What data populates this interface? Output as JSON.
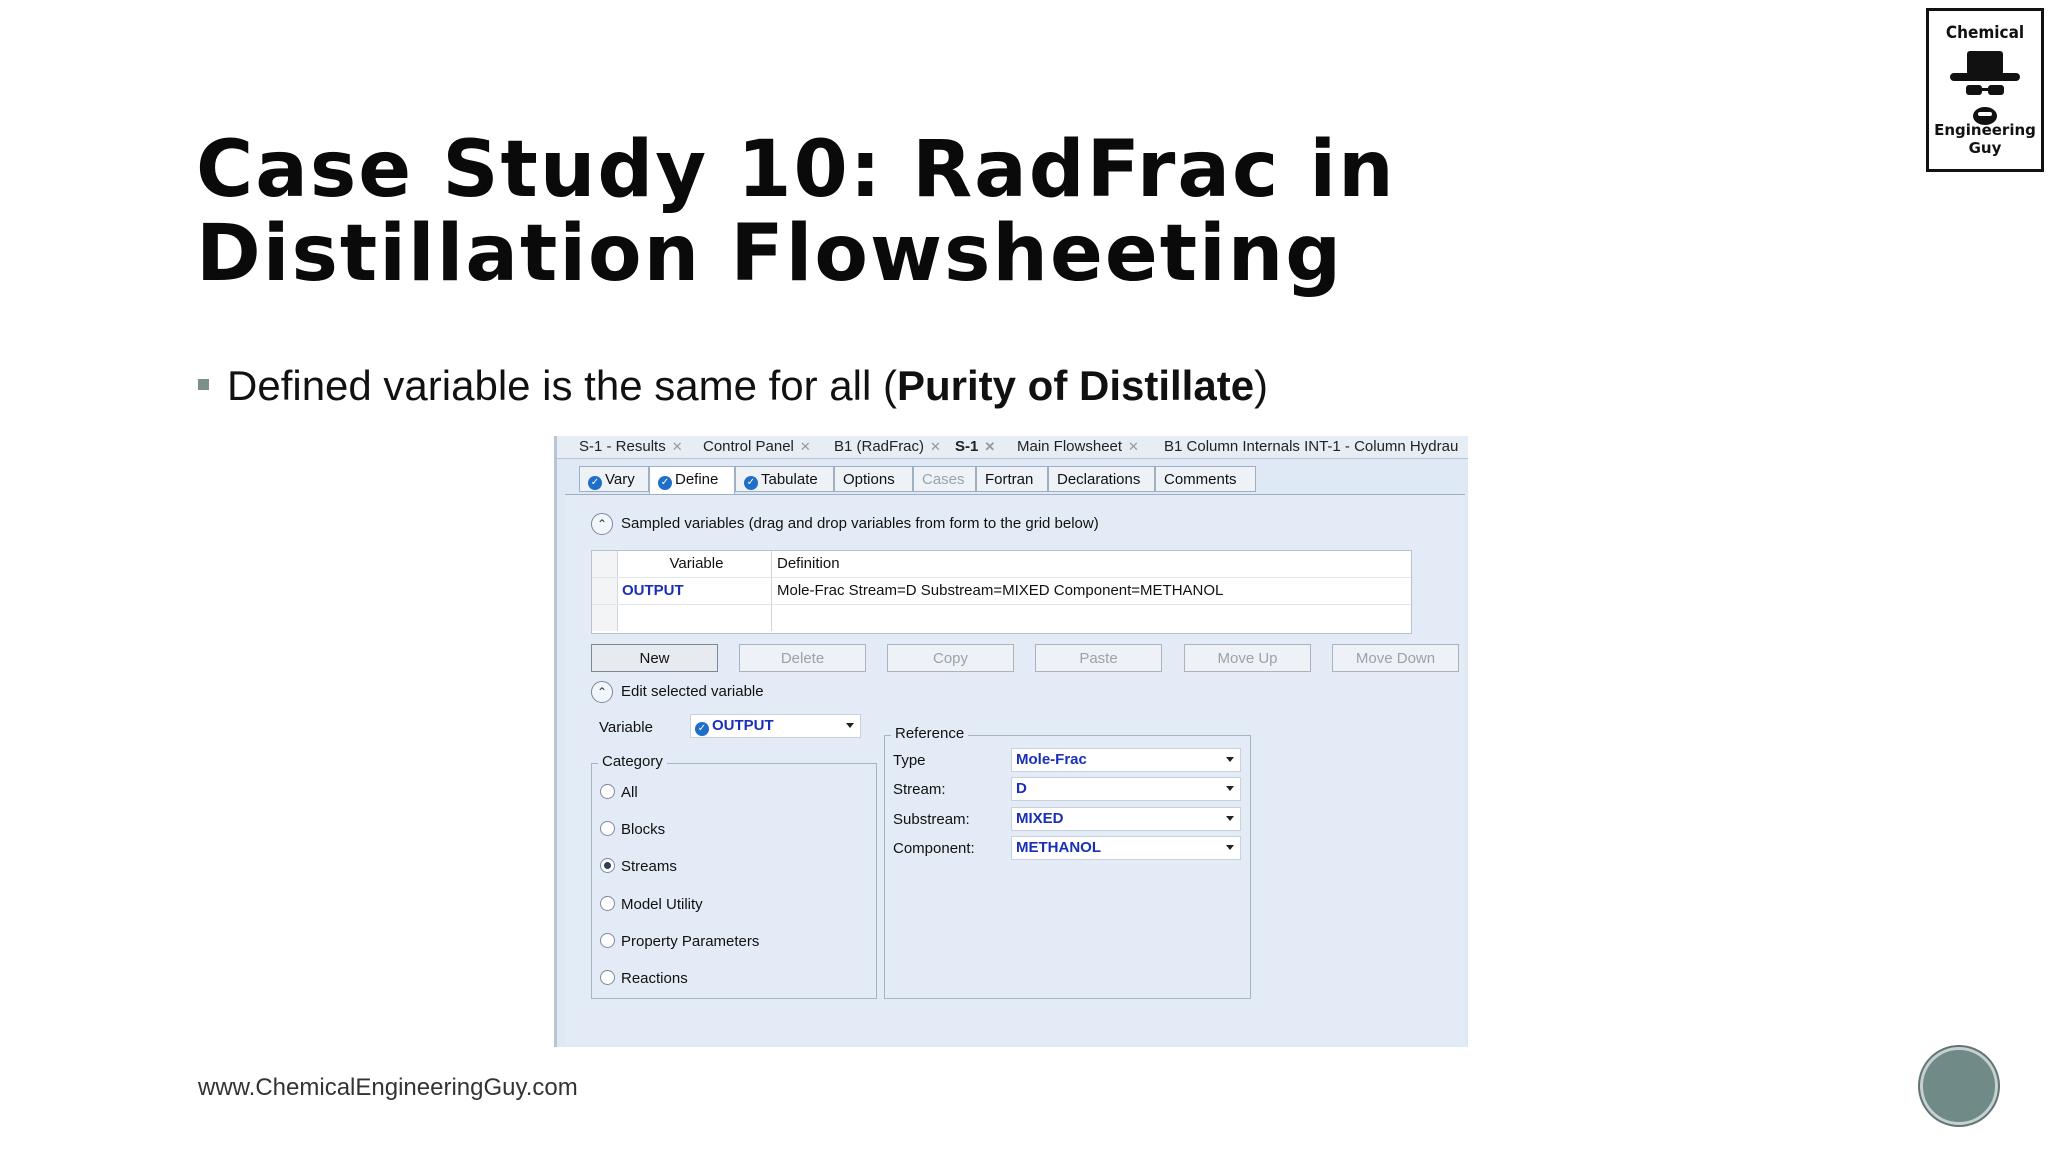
{
  "slide": {
    "title": "Case Study 10: RadFrac in Distillation Flowsheeting",
    "bullet_prefix": "Defined variable is the same for all (",
    "bullet_bold": "Purity of Distillate",
    "bullet_suffix": ")",
    "footer_url": "www.ChemicalEngineeringGuy.com",
    "logo_top": "Chemical",
    "logo_bottom": "Engineering Guy"
  },
  "doc_tabs": [
    {
      "label": "S-1 - Results"
    },
    {
      "label": "Control Panel"
    },
    {
      "label": "B1 (RadFrac)"
    },
    {
      "label": "S-1",
      "active": true
    },
    {
      "label": "Main Flowsheet"
    },
    {
      "label": "B1 Column Internals INT-1 - Column Hydrau"
    }
  ],
  "form_tabs": [
    {
      "label": "Vary",
      "checked": true
    },
    {
      "label": "Define",
      "checked": true,
      "active": true
    },
    {
      "label": "Tabulate",
      "checked": true
    },
    {
      "label": "Options"
    },
    {
      "label": "Cases",
      "disabled": true
    },
    {
      "label": "Fortran"
    },
    {
      "label": "Declarations"
    },
    {
      "label": "Comments"
    }
  ],
  "sampled": {
    "header": "Sampled variables (drag and drop variables from form to the grid below)",
    "col_variable": "Variable",
    "col_definition": "Definition",
    "rows": [
      {
        "variable": "OUTPUT",
        "definition": "Mole-Frac Stream=D Substream=MIXED Component=METHANOL"
      }
    ]
  },
  "buttons": {
    "new": "New",
    "delete": "Delete",
    "copy": "Copy",
    "paste": "Paste",
    "move_up": "Move Up",
    "move_down": "Move Down"
  },
  "edit": {
    "header": "Edit selected variable",
    "variable_label": "Variable",
    "variable_value": "OUTPUT",
    "category_label": "Category",
    "categories": [
      {
        "label": "All",
        "selected": false
      },
      {
        "label": "Blocks",
        "selected": false
      },
      {
        "label": "Streams",
        "selected": true
      },
      {
        "label": "Model Utility",
        "selected": false
      },
      {
        "label": "Property Parameters",
        "selected": false
      },
      {
        "label": "Reactions",
        "selected": false
      }
    ],
    "reference_label": "Reference",
    "reference": [
      {
        "label": "Type",
        "value": "Mole-Frac"
      },
      {
        "label": "Stream:",
        "value": "D"
      },
      {
        "label": "Substream:",
        "value": "MIXED"
      },
      {
        "label": "Component:",
        "value": "METHANOL"
      }
    ]
  }
}
